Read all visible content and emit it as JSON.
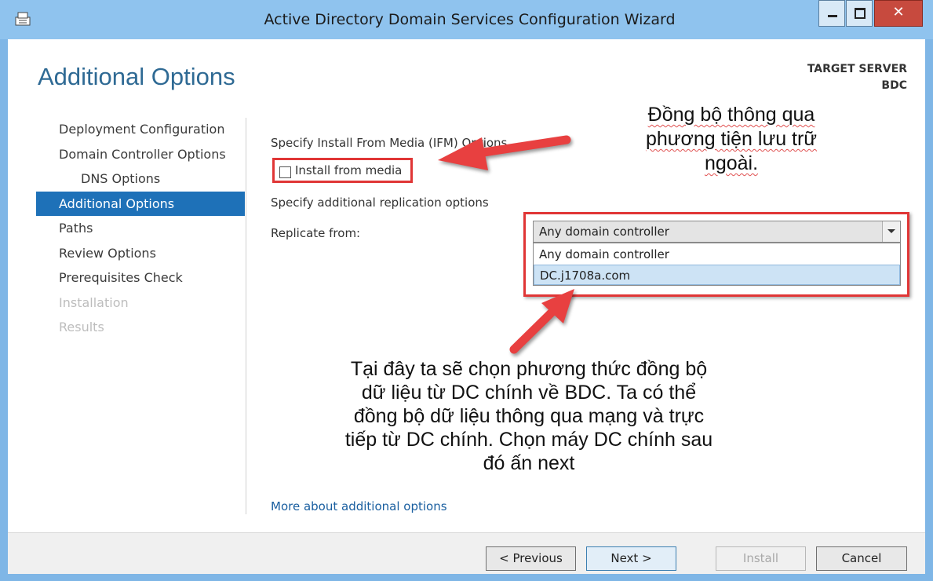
{
  "window": {
    "title": "Active Directory Domain Services Configuration Wizard"
  },
  "header": {
    "page_title": "Additional Options",
    "target_label": "TARGET SERVER",
    "target_value": "BDC"
  },
  "nav": {
    "items": [
      {
        "label": "Deployment Configuration",
        "state": "normal"
      },
      {
        "label": "Domain Controller Options",
        "state": "normal"
      },
      {
        "label": "DNS Options",
        "state": "indent"
      },
      {
        "label": "Additional Options",
        "state": "active"
      },
      {
        "label": "Paths",
        "state": "normal"
      },
      {
        "label": "Review Options",
        "state": "normal"
      },
      {
        "label": "Prerequisites Check",
        "state": "normal"
      },
      {
        "label": "Installation",
        "state": "disabled"
      },
      {
        "label": "Results",
        "state": "disabled"
      }
    ]
  },
  "main": {
    "ifm_heading": "Specify Install From Media (IFM) Options",
    "install_from_media_label": "Install from media",
    "install_from_media_checked": false,
    "replication_heading": "Specify additional replication options",
    "replicate_from_label": "Replicate from:",
    "replicate_from_value": "Any domain controller",
    "replicate_options": [
      "Any domain controller",
      "DC.j1708a.com"
    ],
    "more_link": "More about additional options"
  },
  "annotations": {
    "note1_line1": "Đồng bộ thông qua",
    "note1_line2": "phương tiện lưu trữ",
    "note1_line3": "ngoài.",
    "note2_line1": "Tại đây ta sẽ chọn phương thức đồng bộ",
    "note2_line2": "dữ liệu từ DC chính về BDC. Ta có thể",
    "note2_line3": "đồng bộ dữ liệu thông qua mạng và trực",
    "note2_line4": "tiếp từ DC chính. Chọn máy DC chính sau",
    "note2_line5": "đó ấn next"
  },
  "footer": {
    "previous": "< Previous",
    "next": "Next >",
    "install": "Install",
    "cancel": "Cancel"
  },
  "colors": {
    "accent": "#1e71b8",
    "frame": "#7fb6e6",
    "annotation_red": "#e03636"
  }
}
